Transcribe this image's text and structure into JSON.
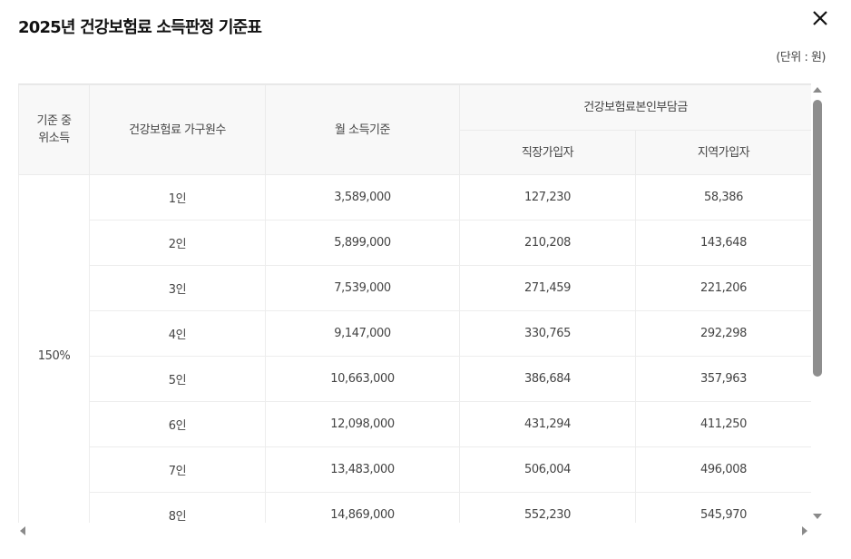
{
  "header": {
    "title": "2025년 건강보험료 소득판정 기준표",
    "close_icon": "close-icon",
    "unit_label": "(단위 : 원)"
  },
  "table": {
    "headers": {
      "median_income": "기준 중위소득",
      "household_size": "건강보험료 가구원수",
      "monthly_income": "월 소득기준",
      "premium_group": "건강보험료본인부담금",
      "employee": "직장가입자",
      "regional": "지역가입자"
    },
    "group_label": "150%",
    "rows": [
      {
        "size": "1인",
        "income": "3,589,000",
        "employee": "127,230",
        "regional": "58,386"
      },
      {
        "size": "2인",
        "income": "5,899,000",
        "employee": "210,208",
        "regional": "143,648"
      },
      {
        "size": "3인",
        "income": "7,539,000",
        "employee": "271,459",
        "regional": "221,206"
      },
      {
        "size": "4인",
        "income": "9,147,000",
        "employee": "330,765",
        "regional": "292,298"
      },
      {
        "size": "5인",
        "income": "10,663,000",
        "employee": "386,684",
        "regional": "357,963"
      },
      {
        "size": "6인",
        "income": "12,098,000",
        "employee": "431,294",
        "regional": "411,250"
      },
      {
        "size": "7인",
        "income": "13,483,000",
        "employee": "506,004",
        "regional": "496,008"
      },
      {
        "size": "8인",
        "income": "14,869,000",
        "employee": "552,230",
        "regional": "545,970"
      }
    ]
  },
  "scrollbars": {
    "vertical_thumb_fraction": 0.68
  }
}
